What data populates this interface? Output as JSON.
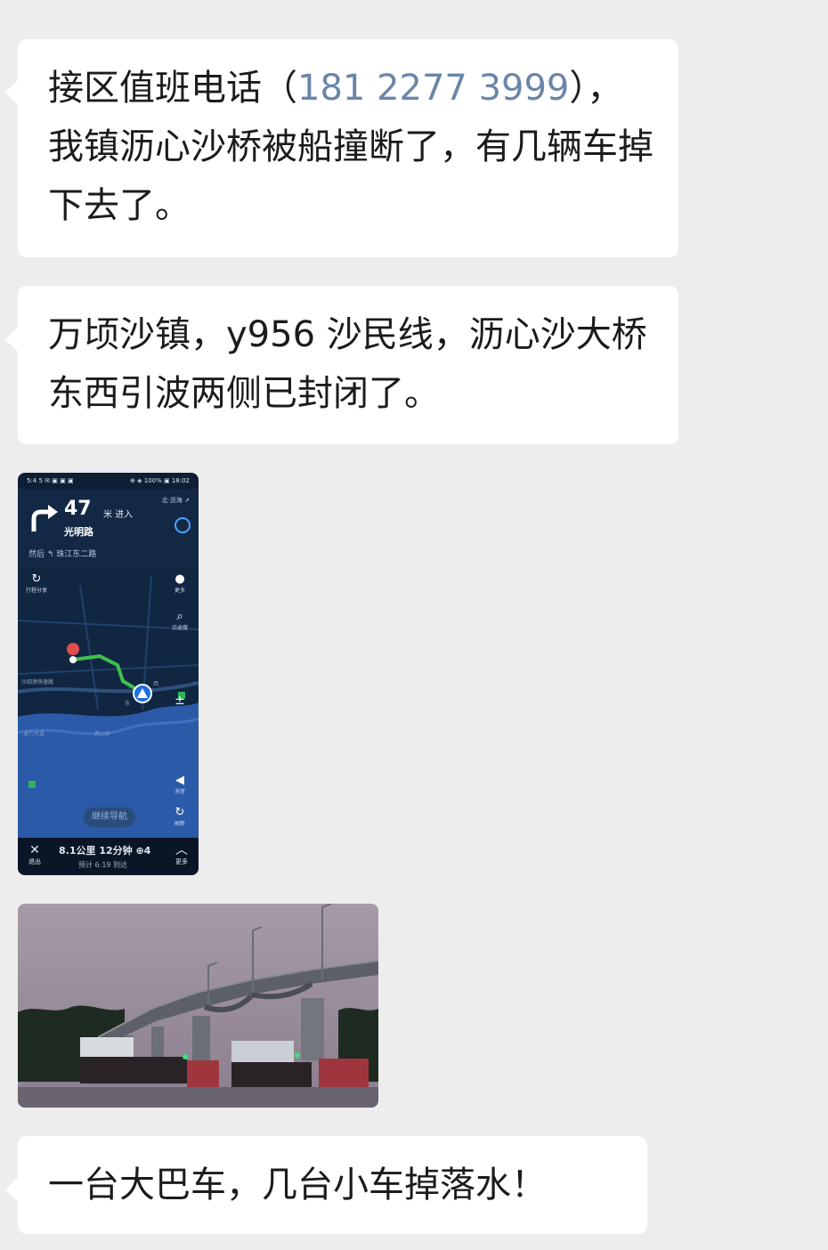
{
  "messages": [
    {
      "text_before": "接区值班电话（",
      "phone": "181 2277 3999",
      "text_after": "），我镇沥心沙桥被船撞断了，有几辆车掉下去了。"
    },
    {
      "text": "万顷沙镇，y956 沙民线，沥心沙大桥东西引波两侧已封闭了。"
    },
    {
      "nav": {
        "status_left": "5:4 5 ✉ ▣ ▣ ▣",
        "status_right": "⊕ ◈ 100% ▣ 18:02",
        "distance": "47",
        "distance_unit": "米 进入",
        "road": "光明路",
        "then_road": "然后 ↰ 珠江东二路",
        "head_right": "北·沥海 ⇗",
        "buttons": {
          "route_label": "行程分享",
          "chat_label": "更多",
          "search_label": "沿途搜",
          "sound_label": "消音",
          "refresh_label": "刷新"
        },
        "map_labels": [
          "沙田港快速路",
          "龙穴大道",
          "沥心沙",
          "东",
          "西"
        ],
        "continue": "继续导航",
        "exit": "退出",
        "trip": "8.1公里 12分钟 ⊕4",
        "eta": "预计 6:19 到达",
        "more": "更多"
      }
    },
    {
      "photo": "bridge"
    },
    {
      "text": "一台大巴车，几台小车掉落水！"
    }
  ],
  "colors": {
    "background": "#ededed",
    "bubble": "#ffffff",
    "phone": "#6a86a8",
    "text": "#1b1b1b"
  }
}
